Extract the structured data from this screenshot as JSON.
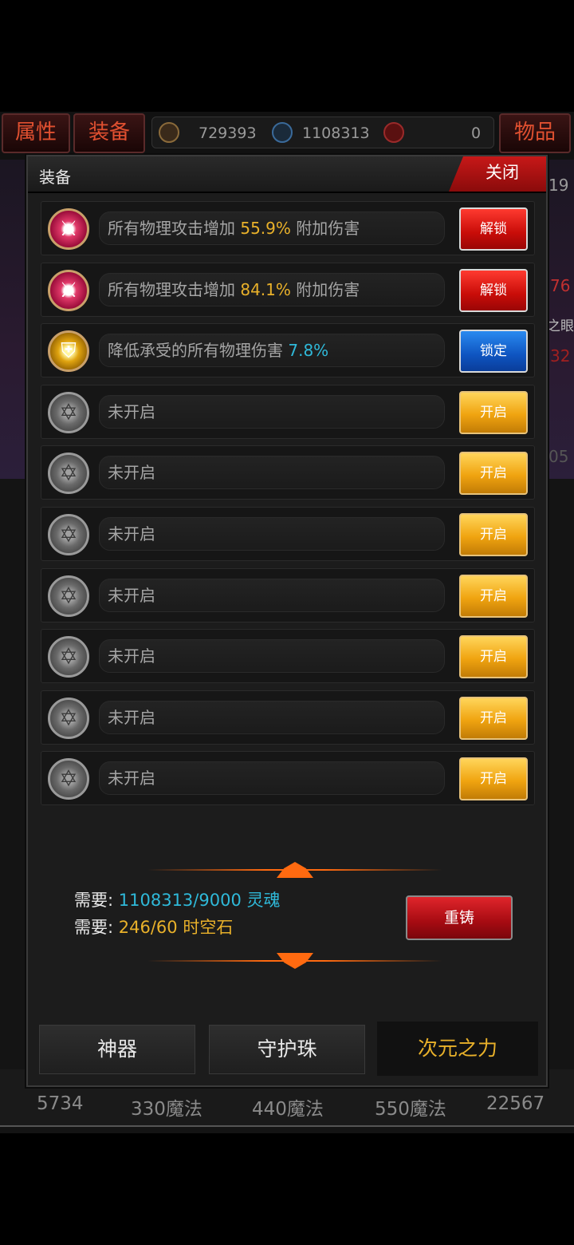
{
  "background": {
    "top_tabs": [
      "属性",
      "装备",
      "物品"
    ],
    "currencies": [
      {
        "icon": "coin-icon",
        "value": "729393"
      },
      {
        "icon": "skull-soul-icon",
        "value": "1108313"
      },
      {
        "icon": "red-gem-icon",
        "value": "0"
      }
    ],
    "side_fragments": [
      "19",
      "76",
      "之眼",
      "32",
      "05"
    ],
    "bottom_values": [
      "5734",
      "330魔法",
      "440魔法",
      "550魔法",
      "22567"
    ]
  },
  "modal": {
    "title": "装备",
    "close_label": "关闭",
    "rows": [
      {
        "icon": "red-sword-emblem-icon",
        "prefix": "所有物理攻击增加 ",
        "value": "55.9%",
        "suffix": " 附加伤害",
        "button": "解锁"
      },
      {
        "icon": "red-sword-emblem-icon",
        "prefix": "所有物理攻击增加 ",
        "value": "84.1%",
        "suffix": " 附加伤害",
        "button": "解锁"
      },
      {
        "icon": "gold-shield-emblem-icon",
        "prefix": "降低承受的所有物理伤害 ",
        "value": "7.8%",
        "suffix": "",
        "button": "锁定"
      },
      {
        "icon": "grey-hexagram-icon",
        "prefix": "未开启",
        "value": "",
        "suffix": "",
        "button": "开启"
      },
      {
        "icon": "grey-hexagram-icon",
        "prefix": "未开启",
        "value": "",
        "suffix": "",
        "button": "开启"
      },
      {
        "icon": "grey-hexagram-icon",
        "prefix": "未开启",
        "value": "",
        "suffix": "",
        "button": "开启"
      },
      {
        "icon": "grey-hexagram-icon",
        "prefix": "未开启",
        "value": "",
        "suffix": "",
        "button": "开启"
      },
      {
        "icon": "grey-hexagram-icon",
        "prefix": "未开启",
        "value": "",
        "suffix": "",
        "button": "开启"
      },
      {
        "icon": "grey-hexagram-icon",
        "prefix": "未开启",
        "value": "",
        "suffix": "",
        "button": "开启"
      },
      {
        "icon": "grey-hexagram-icon",
        "prefix": "未开启",
        "value": "",
        "suffix": "",
        "button": "开启"
      }
    ],
    "requirements": [
      {
        "label": "需要: ",
        "value": "1108313/9000 灵魂"
      },
      {
        "label": "需要: ",
        "value": "246/60 时空石"
      }
    ],
    "recast_label": "重铸",
    "tabs": [
      "神器",
      "守护珠",
      "次元之力"
    ]
  },
  "colors": {
    "accent_gold": "#e9b12a",
    "accent_cyan": "#2fb9d9",
    "unlock_red": "#c80c08",
    "lock_blue": "#0e54c0",
    "open_gold": "#f0a410"
  }
}
